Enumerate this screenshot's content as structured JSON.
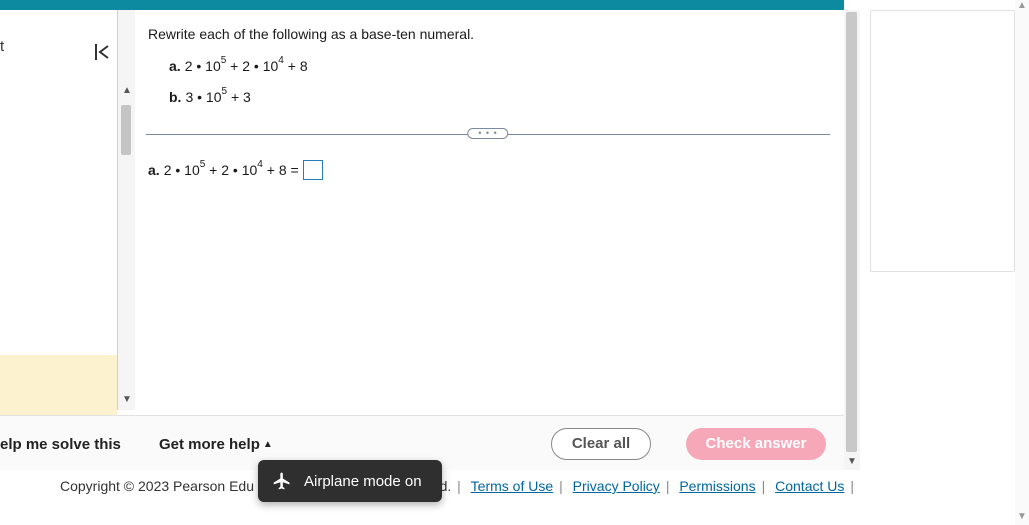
{
  "left": {
    "fragment": "t"
  },
  "question": {
    "instruction": "Rewrite each of the following as a base-ten numeral.",
    "parts": {
      "a_label": "a.",
      "a_pre": "2 • 10",
      "a_exp1": "5",
      "a_mid": " + 2 • 10",
      "a_exp2": "4",
      "a_post": " + 8",
      "b_label": "b.",
      "b_pre": "3 • 10",
      "b_exp1": "5",
      "b_post": " + 3"
    },
    "answer_line": {
      "label": "a.",
      "pre": "2 • 10",
      "exp1": "5",
      "mid": " + 2 • 10",
      "exp2": "4",
      "post": " + 8 ="
    }
  },
  "divider": {
    "dots": "• • •"
  },
  "footer": {
    "help_solve": "elp me solve this",
    "more_help": "Get more help",
    "clear": "Clear all",
    "check": "Check answer"
  },
  "copyright": {
    "pre": "Copyright © 2023 Pearson Edu",
    "post_frag": "ed.",
    "links": {
      "terms": "Terms of Use",
      "privacy": "Privacy Policy",
      "permissions": "Permissions",
      "contact": "Contact Us"
    }
  },
  "toast": {
    "text": "Airplane mode on"
  }
}
